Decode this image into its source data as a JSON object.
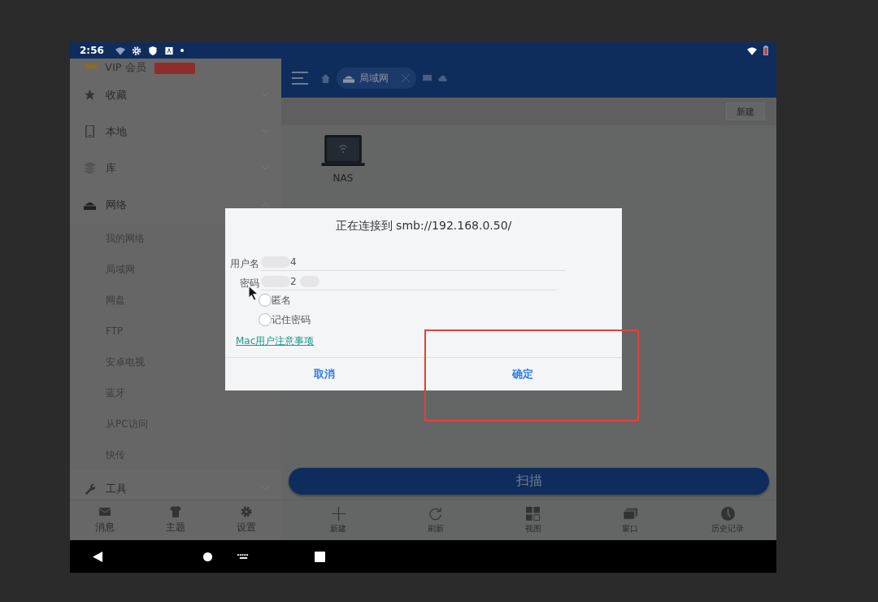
{
  "status_bar": {
    "time": "2:56"
  },
  "sidebar": {
    "vip": {
      "label": "VIP 会员"
    },
    "sections": [
      {
        "label": "收藏",
        "kind": "star",
        "expanded": false
      },
      {
        "label": "本地",
        "kind": "phone",
        "expanded": false
      },
      {
        "label": "库",
        "kind": "stack",
        "expanded": false
      },
      {
        "label": "网络",
        "kind": "router",
        "expanded": true,
        "children": [
          {
            "label": "我的网络"
          },
          {
            "label": "局域网"
          },
          {
            "label": "网盘"
          },
          {
            "label": "FTP"
          },
          {
            "label": "安卓电视"
          },
          {
            "label": "蓝牙"
          },
          {
            "label": "从PC访问"
          },
          {
            "label": "快传"
          }
        ]
      },
      {
        "label": "工具",
        "kind": "wrench",
        "expanded": false
      }
    ],
    "tabs": [
      {
        "label": "消息",
        "kind": "mail"
      },
      {
        "label": "主题",
        "kind": "shirt"
      },
      {
        "label": "设置",
        "kind": "gear"
      }
    ]
  },
  "app_bar": {
    "tab": {
      "label": "局域网"
    }
  },
  "path_bar": {
    "new_button": "新建"
  },
  "items": [
    {
      "label": "NAS"
    }
  ],
  "scan_button": "扫描",
  "toolbar": [
    {
      "label": "新建",
      "kind": "plus"
    },
    {
      "label": "刷新",
      "kind": "refresh"
    },
    {
      "label": "视图",
      "kind": "grid"
    },
    {
      "label": "窗口",
      "kind": "windows"
    },
    {
      "label": "历史记录",
      "kind": "clock"
    }
  ],
  "dialog": {
    "title": "正在连接到 smb://192.168.0.50/",
    "username": {
      "label": "用户名",
      "value": "4"
    },
    "password": {
      "label": "密码",
      "value": "2"
    },
    "options": [
      {
        "label": "匿名",
        "checked": false
      },
      {
        "label": "记住密码",
        "checked": false
      }
    ],
    "link": "Mac用户注意事项",
    "cancel": "取消",
    "ok": "确定"
  }
}
